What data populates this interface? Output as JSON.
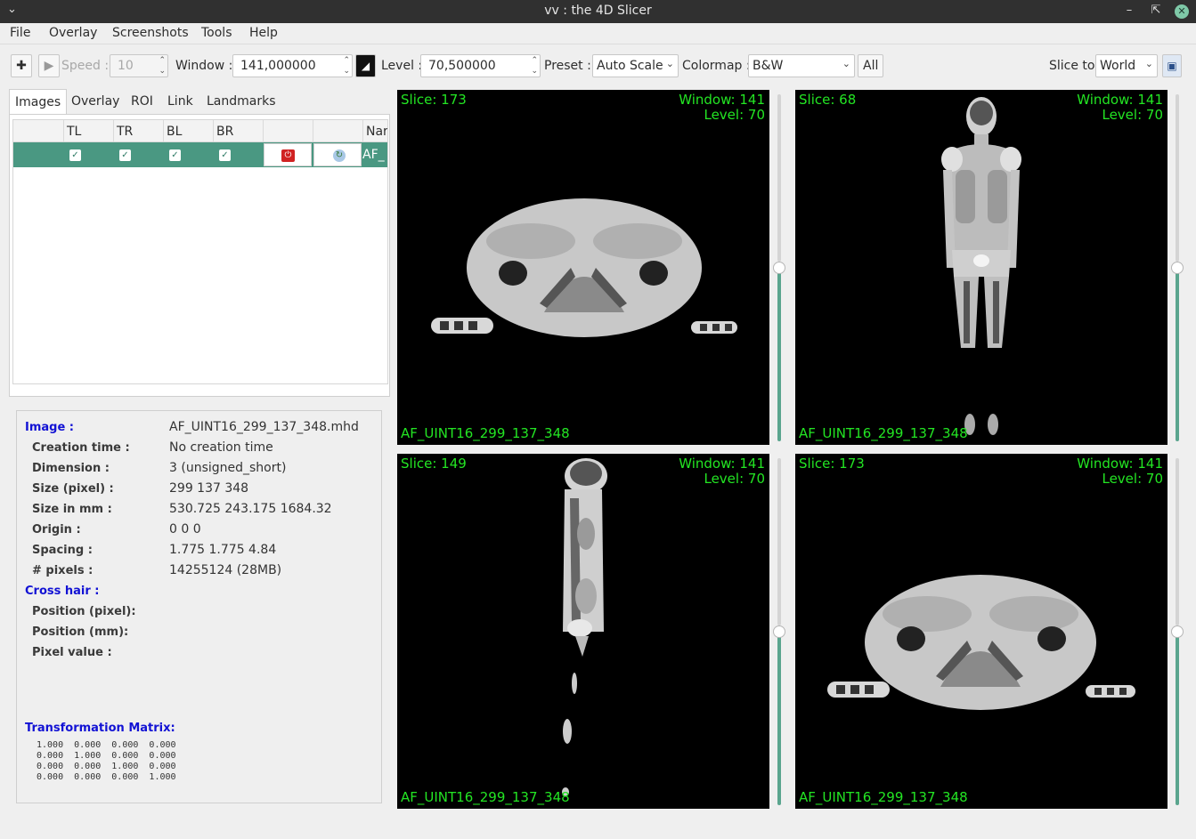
{
  "window": {
    "title": "vv : the 4D Slicer"
  },
  "menu": [
    "File",
    "Overlay",
    "Screenshots",
    "Tools",
    "Help"
  ],
  "toolbar": {
    "speed_label": "Speed :",
    "speed_value": "10",
    "window_label": "Window :",
    "window_value": "141,000000",
    "level_label": "Level :",
    "level_value": "70,500000",
    "preset_label": "Preset :",
    "preset_value": "Auto Scale",
    "colormap_label": "Colormap :",
    "colormap_value": "B&W",
    "all_label": "All",
    "slice_to_label": "Slice to",
    "slice_to_value": "World"
  },
  "tabs": [
    "Images",
    "Overlay",
    "ROI",
    "Link",
    "Landmarks"
  ],
  "image_table": {
    "columns": [
      "TL",
      "TR",
      "BL",
      "BR",
      "",
      "",
      "Nar"
    ],
    "rows": [
      {
        "checked": [
          true,
          true,
          true,
          true
        ],
        "name": "AF_"
      }
    ]
  },
  "info": {
    "image_label": "Image :",
    "image_value": "AF_UINT16_299_137_348.mhd",
    "creation_time_label": "Creation time :",
    "creation_time_value": "No creation time",
    "dimension_label": "Dimension :",
    "dimension_value": "3 (unsigned_short)",
    "size_pixel_label": "Size (pixel) :",
    "size_pixel_value": "299 137 348",
    "size_mm_label": "Size in mm :",
    "size_mm_value": "530.725 243.175 1684.32",
    "origin_label": "Origin :",
    "origin_value": "0 0 0",
    "spacing_label": "Spacing :",
    "spacing_value": "1.775 1.775 4.84",
    "pixels_label": "# pixels :",
    "pixels_value": "14255124 (28MB)",
    "crosshair_label": "Cross hair :",
    "position_pixel_label": "Position (pixel):",
    "position_mm_label": "Position (mm):",
    "pixel_value_label": "Pixel value :",
    "transform_label": "Transformation Matrix:",
    "matrix": "1.000  0.000  0.000  0.000\n0.000  1.000  0.000  0.000\n0.000  0.000  1.000  0.000\n0.000  0.000  0.000  1.000"
  },
  "views": [
    {
      "slice": "Slice: 173",
      "window": "Window: 141",
      "level": "Level: 70",
      "name": "AF_UINT16_299_137_348",
      "slider_level": 0.48
    },
    {
      "slice": "Slice: 68",
      "window": "Window: 141",
      "level": "Level: 70",
      "name": "AF_UINT16_299_137_348",
      "slider_level": 0.48
    },
    {
      "slice": "Slice: 149",
      "window": "Window: 141",
      "level": "Level: 70",
      "name": "AF_UINT16_299_137_348",
      "slider_level": 0.48
    },
    {
      "slice": "Slice: 173",
      "window": "Window: 141",
      "level": "Level: 70",
      "name": "AF_UINT16_299_137_348",
      "slider_level": 0.48
    }
  ],
  "colors": {
    "accent": "#4a9882",
    "overlay_text": "#23e523",
    "section_blue": "#1212d4",
    "titlebar": "#303030"
  }
}
